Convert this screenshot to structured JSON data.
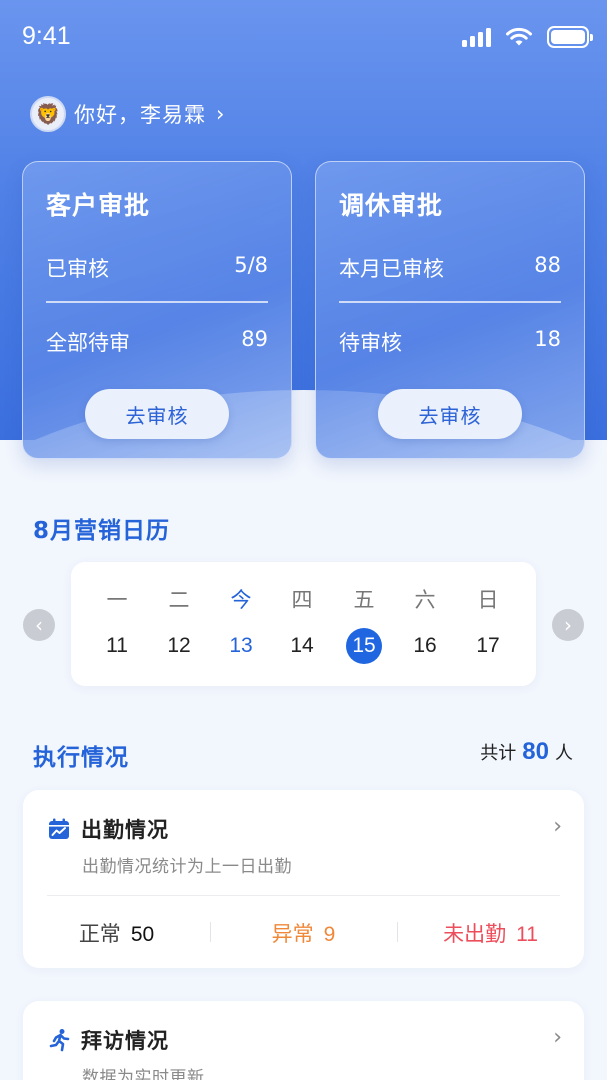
{
  "status_bar": {
    "time": "9:41"
  },
  "header": {
    "greeting": "你好，李易霖",
    "chevron": "›"
  },
  "cards": [
    {
      "title": "客户审批",
      "rows": [
        {
          "label": "已审核",
          "value": "5/8"
        },
        {
          "label": "全部待审",
          "value": "89"
        }
      ],
      "button": "去审核"
    },
    {
      "title": "调休审批",
      "rows": [
        {
          "label": "本月已审核",
          "value": "88"
        },
        {
          "label": "待审核",
          "value": "18"
        }
      ],
      "button": "去审核"
    }
  ],
  "calendar": {
    "title": "8月营销日历",
    "weekdays": [
      "一",
      "二",
      "今",
      "四",
      "五",
      "六",
      "日"
    ],
    "days": [
      "11",
      "12",
      "13",
      "14",
      "15",
      "16",
      "17"
    ],
    "today_index": 2,
    "selected_index": 4,
    "prev_icon": "‹",
    "next_icon": "›"
  },
  "execution": {
    "title": "执行情况",
    "total_prefix": "共计",
    "total": "80",
    "total_unit": "人"
  },
  "attendance": {
    "icon": "calendar-chart-icon",
    "title": "出勤情况",
    "subtitle": "出勤情况统计为上一日出勤",
    "stats": [
      {
        "label": "正常",
        "value": "50",
        "color": "#111111"
      },
      {
        "label": "异常",
        "value": "9",
        "color": "#f0883a"
      },
      {
        "label": "未出勤",
        "value": "11",
        "color": "#ec4e5b"
      }
    ]
  },
  "visits": {
    "icon": "running-person-icon",
    "title": "拜访情况",
    "subtitle": "数据为实时更新"
  },
  "colors": {
    "primary": "#2563d9",
    "header_blue": "#4f80e6",
    "warning": "#f0883a",
    "danger": "#ec4e5b"
  }
}
